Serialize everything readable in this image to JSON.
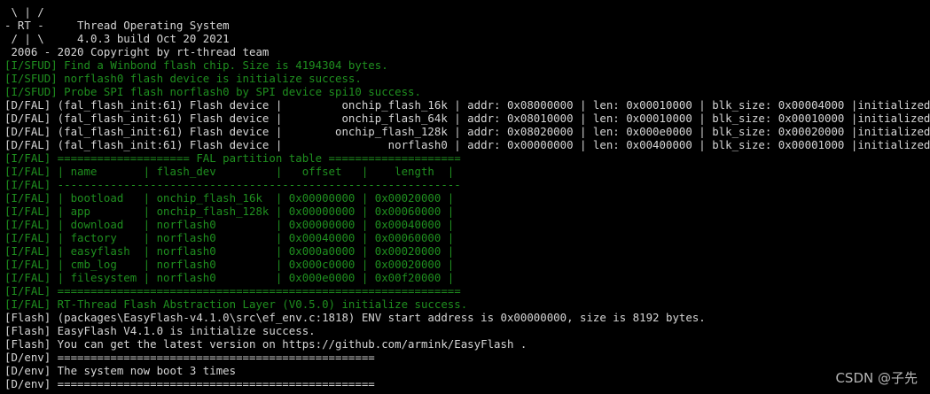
{
  "terminal": {
    "lines": [
      {
        "text": " \\ | /",
        "color": "white"
      },
      {
        "text": "- RT -     Thread Operating System",
        "color": "white"
      },
      {
        "text": " / | \\     4.0.3 build Oct 20 2021",
        "color": "white"
      },
      {
        "text": " 2006 - 2020 Copyright by rt-thread team",
        "color": "white"
      },
      {
        "text": "[I/SFUD] Find a Winbond flash chip. Size is 4194304 bytes.",
        "color": "green"
      },
      {
        "text": "[I/SFUD] norflash0 flash device is initialize success.",
        "color": "green"
      },
      {
        "text": "[I/SFUD] Probe SPI flash norflash0 by SPI device spi10 success.",
        "color": "green"
      },
      {
        "text": "[D/FAL] (fal_flash_init:61) Flash device |         onchip_flash_16k | addr: 0x08000000 | len: 0x00010000 | blk_size: 0x00004000 |initialized finish.",
        "color": "white"
      },
      {
        "text": "[D/FAL] (fal_flash_init:61) Flash device |         onchip_flash_64k | addr: 0x08010000 | len: 0x00010000 | blk_size: 0x00010000 |initialized finish.",
        "color": "white"
      },
      {
        "text": "[D/FAL] (fal_flash_init:61) Flash device |        onchip_flash_128k | addr: 0x08020000 | len: 0x000e0000 | blk_size: 0x00020000 |initialized finish.",
        "color": "white"
      },
      {
        "text": "[D/FAL] (fal_flash_init:61) Flash device |                norflash0 | addr: 0x00000000 | len: 0x00400000 | blk_size: 0x00001000 |initialized finish.",
        "color": "white"
      },
      {
        "text": "[I/FAL] ==================== FAL partition table ====================",
        "color": "green"
      },
      {
        "text": "[I/FAL] | name       | flash_dev         |   offset   |    length  |",
        "color": "green"
      },
      {
        "text": "[I/FAL] -------------------------------------------------------------",
        "color": "green"
      },
      {
        "text": "[I/FAL] | bootload   | onchip_flash_16k  | 0x00000000 | 0x00020000 |",
        "color": "green"
      },
      {
        "text": "[I/FAL] | app        | onchip_flash_128k | 0x00000000 | 0x00060000 |",
        "color": "green"
      },
      {
        "text": "[I/FAL] | download   | norflash0         | 0x00000000 | 0x00040000 |",
        "color": "green"
      },
      {
        "text": "[I/FAL] | factory    | norflash0         | 0x00040000 | 0x00060000 |",
        "color": "green"
      },
      {
        "text": "[I/FAL] | easyflash  | norflash0         | 0x000a0000 | 0x00020000 |",
        "color": "green"
      },
      {
        "text": "[I/FAL] | cmb_log    | norflash0         | 0x000c0000 | 0x00020000 |",
        "color": "green"
      },
      {
        "text": "[I/FAL] | filesystem | norflash0         | 0x000e0000 | 0x00f20000 |",
        "color": "green"
      },
      {
        "text": "[I/FAL] =============================================================",
        "color": "green"
      },
      {
        "text": "[I/FAL] RT-Thread Flash Abstraction Layer (V0.5.0) initialize success.",
        "color": "green"
      },
      {
        "text": "[Flash] (packages\\EasyFlash-v4.1.0\\src\\ef_env.c:1818) ENV start address is 0x00000000, size is 8192 bytes.",
        "color": "white"
      },
      {
        "text": "[Flash] EasyFlash V4.1.0 is initialize success.",
        "color": "white"
      },
      {
        "text": "[Flash] You can get the latest version on https://github.com/armink/EasyFlash .",
        "color": "white"
      },
      {
        "text": "[D/env] ================================================",
        "color": "white"
      },
      {
        "text": "[D/env] The system now boot 3 times",
        "color": "white"
      },
      {
        "text": "[D/env] ================================================",
        "color": "white"
      }
    ]
  },
  "watermark": {
    "text": "CSDN @子先"
  },
  "colors": {
    "background": "#000000",
    "white_text": "#d6d6d6",
    "green_text": "#1f8f1f"
  }
}
